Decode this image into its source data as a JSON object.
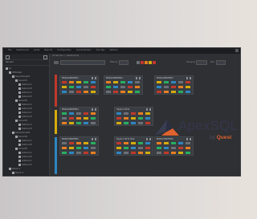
{
  "titlebar": {
    "menu": [
      "File",
      "Dashboards",
      "Alerts",
      "Reports",
      "Configuration",
      "Administration",
      "Tool tips",
      "Options"
    ],
    "right_text": "ApexSQL"
  },
  "sidebar": {
    "header": "Servers",
    "tree": [
      {
        "label": "All",
        "depth": 0
      },
      {
        "label": "VMCluster",
        "depth": 1
      },
      {
        "label": "ServerGroup01",
        "depth": 2
      },
      {
        "label": "Server01",
        "depth": 3
      },
      {
        "label": "Instance A",
        "depth": 4
      },
      {
        "label": "Instance B",
        "depth": 4
      },
      {
        "label": "Instance C",
        "depth": 4
      },
      {
        "label": "Instance D",
        "depth": 4
      },
      {
        "label": "Server02",
        "depth": 3
      },
      {
        "label": "Instance A",
        "depth": 4
      },
      {
        "label": "Instance B",
        "depth": 4
      },
      {
        "label": "Instance C",
        "depth": 4
      },
      {
        "label": "Instance D",
        "depth": 4
      },
      {
        "label": "Server03",
        "depth": 3
      },
      {
        "label": "Instance A",
        "depth": 4
      },
      {
        "label": "Instance B",
        "depth": 4
      },
      {
        "label": "ServerGroup02",
        "depth": 2
      },
      {
        "label": "Server04",
        "depth": 3
      },
      {
        "label": "Instance A",
        "depth": 4
      },
      {
        "label": "Instance B",
        "depth": 4
      },
      {
        "label": "Server05",
        "depth": 3
      },
      {
        "label": "Instance A",
        "depth": 4
      },
      {
        "label": "Instance B",
        "depth": 4
      },
      {
        "label": "Instance C",
        "depth": 4
      },
      {
        "label": "Instance D",
        "depth": 4
      },
      {
        "label": "Server 1",
        "depth": 1
      },
      {
        "label": "Server 2",
        "depth": 2
      }
    ]
  },
  "main": {
    "breadcrumb": "All Servers > Dashboards",
    "toolbar": {
      "filter_label": "Filter by",
      "group_label": "Group by",
      "sort_label": "Sort"
    },
    "cards": [
      {
        "name": "MSSQLSERVER01"
      },
      {
        "name": "MSSQLSERVER02"
      },
      {
        "name": "MSSQLSERVER03"
      },
      {
        "name": "MSSQLSERVER04"
      },
      {
        "name": "Hyper-V 2012"
      },
      {
        "name": "MSSQLSERVER05"
      },
      {
        "name": "Hyper-V 2012 Host"
      },
      {
        "name": "MSSQLSERVER06"
      }
    ]
  },
  "logo": {
    "brand": "ApexSQL",
    "by": "by",
    "company": "Quest",
    "colors": {
      "triangle_dark": "#3a3e52",
      "triangle_accent": "#e0622e"
    }
  },
  "colors": {
    "red": "#c0392b",
    "orange": "#e67e22",
    "yellow": "#d4ac0d",
    "green": "#27ae60",
    "blue": "#2e86c1",
    "gray": "#6c6f75"
  }
}
